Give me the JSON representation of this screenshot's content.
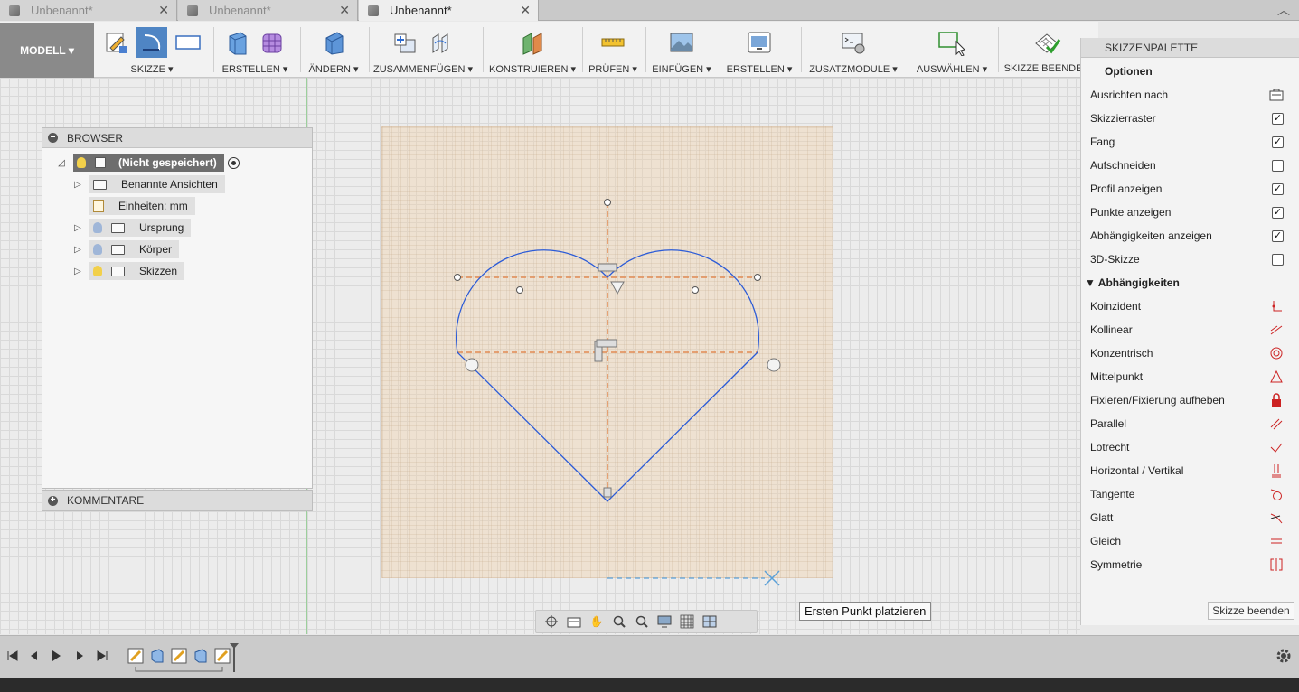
{
  "tabs": [
    {
      "label": "Unbenannt*",
      "active": false
    },
    {
      "label": "Unbenannt*",
      "active": false
    },
    {
      "label": "Unbenannt*",
      "active": true
    }
  ],
  "toolbar": {
    "workspace": "MODELL ▾",
    "groups": [
      {
        "label": "SKIZZE ▾"
      },
      {
        "label": "ERSTELLEN ▾"
      },
      {
        "label": "ÄNDERN ▾"
      },
      {
        "label": "ZUSAMMENFÜGEN ▾"
      },
      {
        "label": "KONSTRUIEREN ▾"
      },
      {
        "label": "PRÜFEN ▾"
      },
      {
        "label": "EINFÜGEN ▾"
      },
      {
        "label": "ERSTELLEN ▾"
      },
      {
        "label": "ZUSATZMODULE ▾"
      },
      {
        "label": "AUSWÄHLEN ▾"
      },
      {
        "label": "SKIZZE BEENDEN"
      }
    ]
  },
  "browser": {
    "title": "BROWSER",
    "root": "(Nicht gespeichert)",
    "items": [
      {
        "label": "Benannte Ansichten"
      },
      {
        "label": "Einheiten: mm"
      },
      {
        "label": "Ursprung"
      },
      {
        "label": "Körper"
      },
      {
        "label": "Skizzen"
      }
    ]
  },
  "comments": {
    "title": "KOMMENTARE"
  },
  "palette": {
    "title": "SKIZZENPALETTE",
    "options_title": "Optionen",
    "options": [
      {
        "label": "Ausrichten nach",
        "checked": null
      },
      {
        "label": "Skizzierraster",
        "checked": true
      },
      {
        "label": "Fang",
        "checked": true
      },
      {
        "label": "Aufschneiden",
        "checked": false
      },
      {
        "label": "Profil anzeigen",
        "checked": true
      },
      {
        "label": "Punkte anzeigen",
        "checked": true
      },
      {
        "label": "Abhängigkeiten anzeigen",
        "checked": true
      },
      {
        "label": "3D-Skizze",
        "checked": false
      }
    ],
    "constraints_title": "Abhängigkeiten",
    "constraints": [
      {
        "label": "Koinzident",
        "icon": "coincident-icon"
      },
      {
        "label": "Kollinear",
        "icon": "collinear-icon"
      },
      {
        "label": "Konzentrisch",
        "icon": "concentric-icon"
      },
      {
        "label": "Mittelpunkt",
        "icon": "midpoint-icon"
      },
      {
        "label": "Fixieren/Fixierung aufheben",
        "icon": "lock-icon"
      },
      {
        "label": "Parallel",
        "icon": "parallel-icon"
      },
      {
        "label": "Lotrecht",
        "icon": "perpendicular-icon"
      },
      {
        "label": "Horizontal / Vertikal",
        "icon": "horizontal-vertical-icon"
      },
      {
        "label": "Tangente",
        "icon": "tangent-icon"
      },
      {
        "label": "Glatt",
        "icon": "smooth-icon"
      },
      {
        "label": "Gleich",
        "icon": "equal-icon"
      },
      {
        "label": "Symmetrie",
        "icon": "symmetry-icon"
      }
    ],
    "finish_button": "Skizze beenden"
  },
  "tooltip": "Ersten Punkt platzieren",
  "colors": {
    "accent": "#4f85c4",
    "sketch_line": "#2b5bd7",
    "construction": "#e07a3a",
    "constraint_red": "#cc2222"
  }
}
